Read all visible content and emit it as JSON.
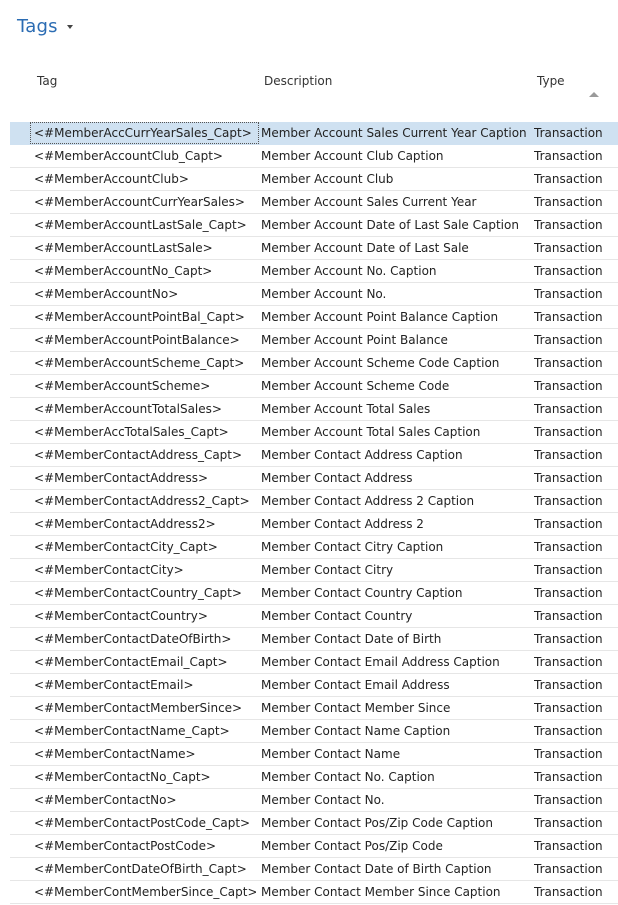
{
  "header": {
    "title": "Tags"
  },
  "columns": {
    "tag": "Tag",
    "description": "Description",
    "type": "Type"
  },
  "rows": [
    {
      "tag": "<#MemberAccCurrYearSales_Capt>",
      "description": "Member Account Sales Current Year  Caption",
      "type": "Transaction"
    },
    {
      "tag": "<#MemberAccountClub_Capt>",
      "description": "Member Account Club Caption",
      "type": "Transaction"
    },
    {
      "tag": "<#MemberAccountClub>",
      "description": "Member Account Club",
      "type": "Transaction"
    },
    {
      "tag": "<#MemberAccountCurrYearSales>",
      "description": "Member Account Sales Current Year",
      "type": "Transaction"
    },
    {
      "tag": "<#MemberAccountLastSale_Capt>",
      "description": "Member Account Date of Last Sale Caption",
      "type": "Transaction"
    },
    {
      "tag": "<#MemberAccountLastSale>",
      "description": "Member Account Date of Last Sale",
      "type": "Transaction"
    },
    {
      "tag": "<#MemberAccountNo_Capt>",
      "description": "Member Account No. Caption",
      "type": "Transaction"
    },
    {
      "tag": "<#MemberAccountNo>",
      "description": "Member Account No.",
      "type": "Transaction"
    },
    {
      "tag": "<#MemberAccountPointBal_Capt>",
      "description": "Member Account Point Balance Caption",
      "type": "Transaction"
    },
    {
      "tag": "<#MemberAccountPointBalance>",
      "description": "Member Account Point Balance",
      "type": "Transaction"
    },
    {
      "tag": "<#MemberAccountScheme_Capt>",
      "description": "Member Account Scheme Code Caption",
      "type": "Transaction"
    },
    {
      "tag": "<#MemberAccountScheme>",
      "description": "Member Account Scheme Code",
      "type": "Transaction"
    },
    {
      "tag": "<#MemberAccountTotalSales>",
      "description": "Member Account Total Sales",
      "type": "Transaction"
    },
    {
      "tag": "<#MemberAccTotalSales_Capt>",
      "description": "Member Account Total Sales Caption",
      "type": "Transaction"
    },
    {
      "tag": "<#MemberContactAddress_Capt>",
      "description": "Member Contact Address Caption",
      "type": "Transaction"
    },
    {
      "tag": "<#MemberContactAddress>",
      "description": "Member Contact Address",
      "type": "Transaction"
    },
    {
      "tag": "<#MemberContactAddress2_Capt>",
      "description": "Member Contact Address 2 Caption",
      "type": "Transaction"
    },
    {
      "tag": "<#MemberContactAddress2>",
      "description": "Member Contact Address 2",
      "type": "Transaction"
    },
    {
      "tag": "<#MemberContactCity_Capt>",
      "description": "Member Contact Citry Caption",
      "type": "Transaction"
    },
    {
      "tag": "<#MemberContactCity>",
      "description": "Member Contact Citry",
      "type": "Transaction"
    },
    {
      "tag": "<#MemberContactCountry_Capt>",
      "description": "Member Contact Country Caption",
      "type": "Transaction"
    },
    {
      "tag": "<#MemberContactCountry>",
      "description": "Member Contact Country",
      "type": "Transaction"
    },
    {
      "tag": "<#MemberContactDateOfBirth>",
      "description": "Member Contact Date of Birth",
      "type": "Transaction"
    },
    {
      "tag": "<#MemberContactEmail_Capt>",
      "description": "Member Contact Email Address Caption",
      "type": "Transaction"
    },
    {
      "tag": "<#MemberContactEmail>",
      "description": "Member Contact Email Address",
      "type": "Transaction"
    },
    {
      "tag": "<#MemberContactMemberSince>",
      "description": "Member Contact Member Since",
      "type": "Transaction"
    },
    {
      "tag": "<#MemberContactName_Capt>",
      "description": "Member Contact Name Caption",
      "type": "Transaction"
    },
    {
      "tag": "<#MemberContactName>",
      "description": "Member Contact Name",
      "type": "Transaction"
    },
    {
      "tag": "<#MemberContactNo_Capt>",
      "description": "Member Contact No. Caption",
      "type": "Transaction"
    },
    {
      "tag": "<#MemberContactNo>",
      "description": "Member Contact No.",
      "type": "Transaction"
    },
    {
      "tag": "<#MemberContactPostCode_Capt>",
      "description": "Member Contact Pos/Zip Code Caption",
      "type": "Transaction"
    },
    {
      "tag": "<#MemberContactPostCode>",
      "description": "Member Contact Pos/Zip Code",
      "type": "Transaction"
    },
    {
      "tag": "<#MemberContDateOfBirth_Capt>",
      "description": "Member Contact Date of Birth Caption",
      "type": "Transaction"
    },
    {
      "tag": "<#MemberContMemberSince_Capt>",
      "description": "Member Contact Member Since Caption",
      "type": "Transaction"
    }
  ]
}
